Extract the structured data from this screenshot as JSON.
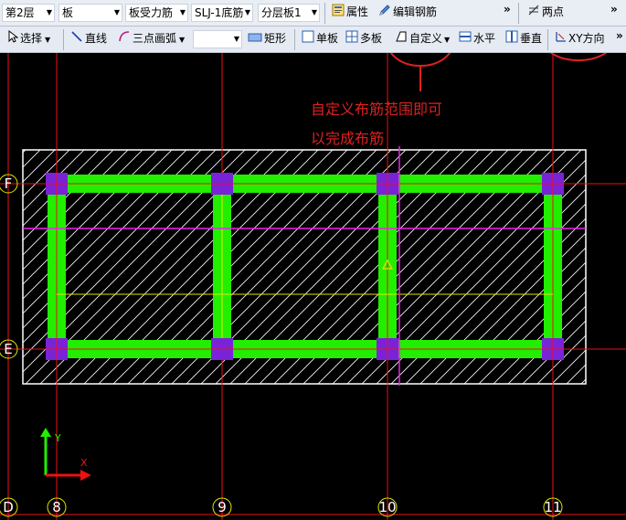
{
  "toolbar1": {
    "floor": "第2层",
    "component": "板",
    "rebar_type": "板受力筋",
    "rebar_name": "SLJ-1底筋",
    "layer": "分层板1",
    "properties_btn": "属性",
    "edit_rebar_btn": "编辑钢筋",
    "two_points_btn": "两点"
  },
  "toolbar2": {
    "select_btn": "选择",
    "line_btn": "直线",
    "arc_btn": "三点画弧",
    "arc_combo_value": "",
    "rect_btn": "矩形",
    "single_board_btn": "单板",
    "multi_board_btn": "多板",
    "custom_btn": "自定义",
    "horizontal_btn": "水平",
    "vertical_btn": "垂直",
    "xy_btn": "XY方向"
  },
  "annotation": {
    "line1": "自定义布筋范围即可",
    "line2": "以完成布筋"
  },
  "axes": {
    "F": "F",
    "E": "E",
    "D": "D",
    "c8": "8",
    "c9": "9",
    "c10": "10",
    "c11": "11"
  },
  "coord": {
    "y": "Y",
    "x": "X"
  },
  "colors": {
    "beam": "#22ee00",
    "column": "#7a22d8",
    "grid": "#ee1111",
    "rebar_line": "#ee22ee",
    "highlight": "#e6e600",
    "annotation": "#e02020"
  }
}
